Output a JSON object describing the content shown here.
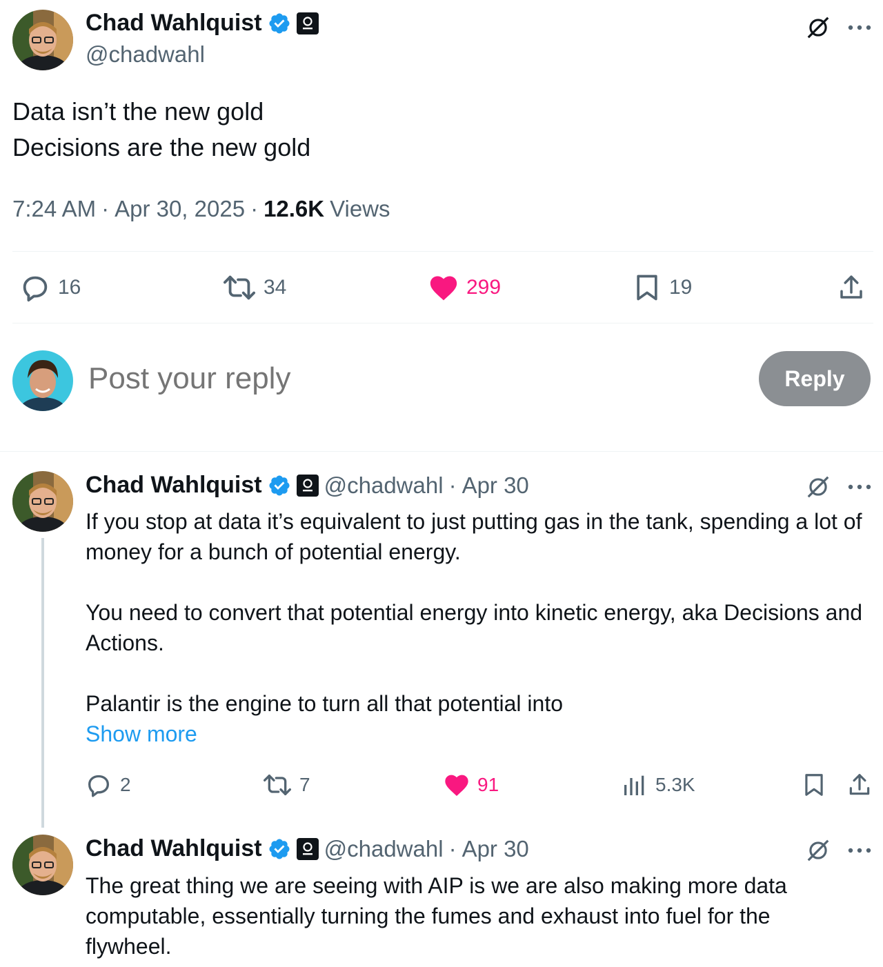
{
  "main_post": {
    "author_name": "Chad Wahlquist",
    "handle": "@chadwahl",
    "text_lines": [
      "Data isn’t the new gold",
      "Decisions are the new gold"
    ],
    "time": "7:24 AM",
    "date": "Apr 30, 2025",
    "views_count": "12.6K",
    "views_label": "Views",
    "replies": "16",
    "reposts": "34",
    "likes": "299",
    "bookmarks": "19"
  },
  "composer": {
    "placeholder": "Post your reply",
    "reply_label": "Reply"
  },
  "replies": [
    {
      "author_name": "Chad Wahlquist",
      "handle": "@chadwahl",
      "date": "Apr 30",
      "paragraphs": [
        "If you stop at data it’s equivalent to just putting gas in the tank, spending a lot of money for a bunch of potential energy.",
        "You need to convert that potential energy into kinetic energy, aka Decisions and Actions.",
        "Palantir is the engine to turn all that potential into"
      ],
      "show_more": "Show more",
      "replies": "2",
      "reposts": "7",
      "likes": "91",
      "views": "5.3K"
    },
    {
      "author_name": "Chad Wahlquist",
      "handle": "@chadwahl",
      "date": "Apr 30",
      "paragraphs": [
        "The great thing we are seeing with AIP is we are also making more data computable, essentially turning the fumes and exhaust into fuel for the flywheel."
      ]
    }
  ],
  "separator": "·",
  "colors": {
    "like": "#f91880",
    "link": "#1d9bf0",
    "verified": "#1d9bf0",
    "muted": "#536471"
  },
  "icons": [
    "verified-badge-icon",
    "affiliate-badge-icon",
    "grok-icon",
    "more-icon",
    "reply-icon",
    "repost-icon",
    "like-icon",
    "bookmark-icon",
    "share-icon",
    "views-icon"
  ]
}
